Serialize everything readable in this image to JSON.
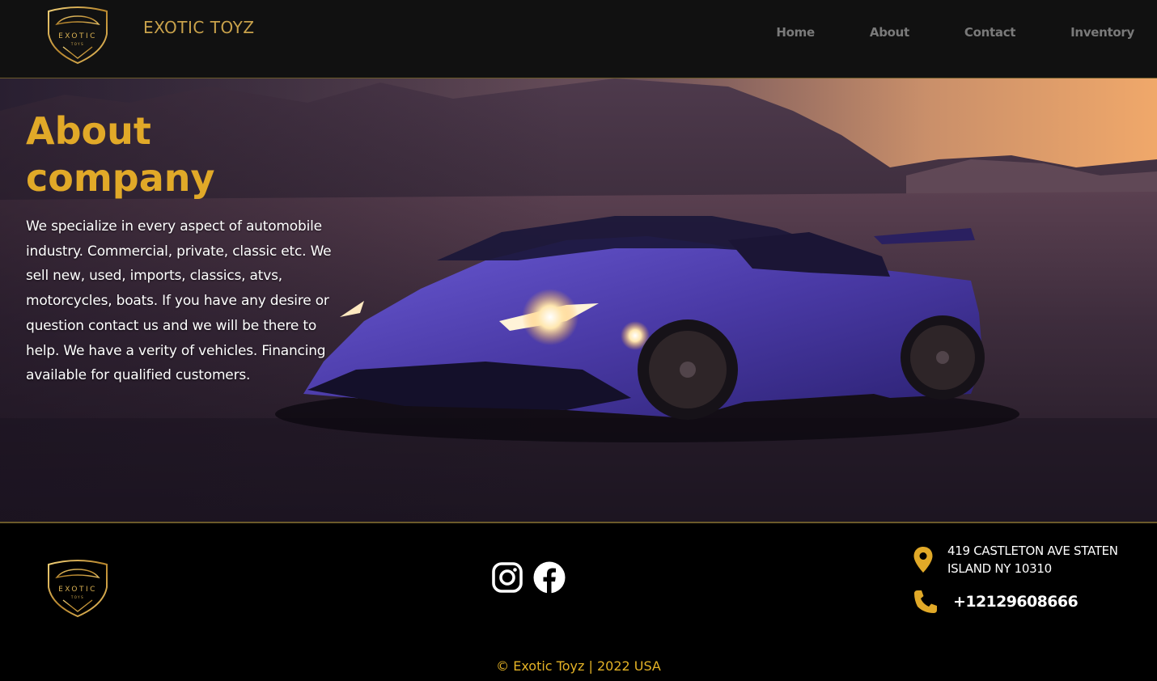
{
  "header": {
    "logo_text": "EXOTIC",
    "logo_subtext": "TOYS",
    "brand_name": "EXOTIC TOYZ",
    "nav": [
      {
        "label": "Home"
      },
      {
        "label": "About"
      },
      {
        "label": "Contact"
      },
      {
        "label": "Inventory"
      }
    ]
  },
  "hero": {
    "title_line1": "About",
    "title_line2": "company",
    "description": "We specialize in every aspect of automobile industry. Commercial, private, classic etc. We sell new, used, imports, classics, atvs, motorcycles, boats. If you have any desire or question contact us and we will be there to help. We have a verity of vehicles. Financing available for qualified customers.",
    "image": "purple-supercar-mountains-sunset"
  },
  "footer": {
    "logo_text": "EXOTIC",
    "logo_subtext": "TOYS",
    "social": [
      {
        "icon": "instagram-icon"
      },
      {
        "icon": "facebook-icon"
      }
    ],
    "address": "419 CASTLETON AVE STATEN ISLAND NY 10310",
    "phone": "+12129608666",
    "copyright": "© Exotic Toyz | 2022 USA"
  },
  "colors": {
    "accent_gold": "#e1a928",
    "header_bg": "#111111",
    "footer_bg": "#000000",
    "nav_text": "#7a7a7a"
  }
}
